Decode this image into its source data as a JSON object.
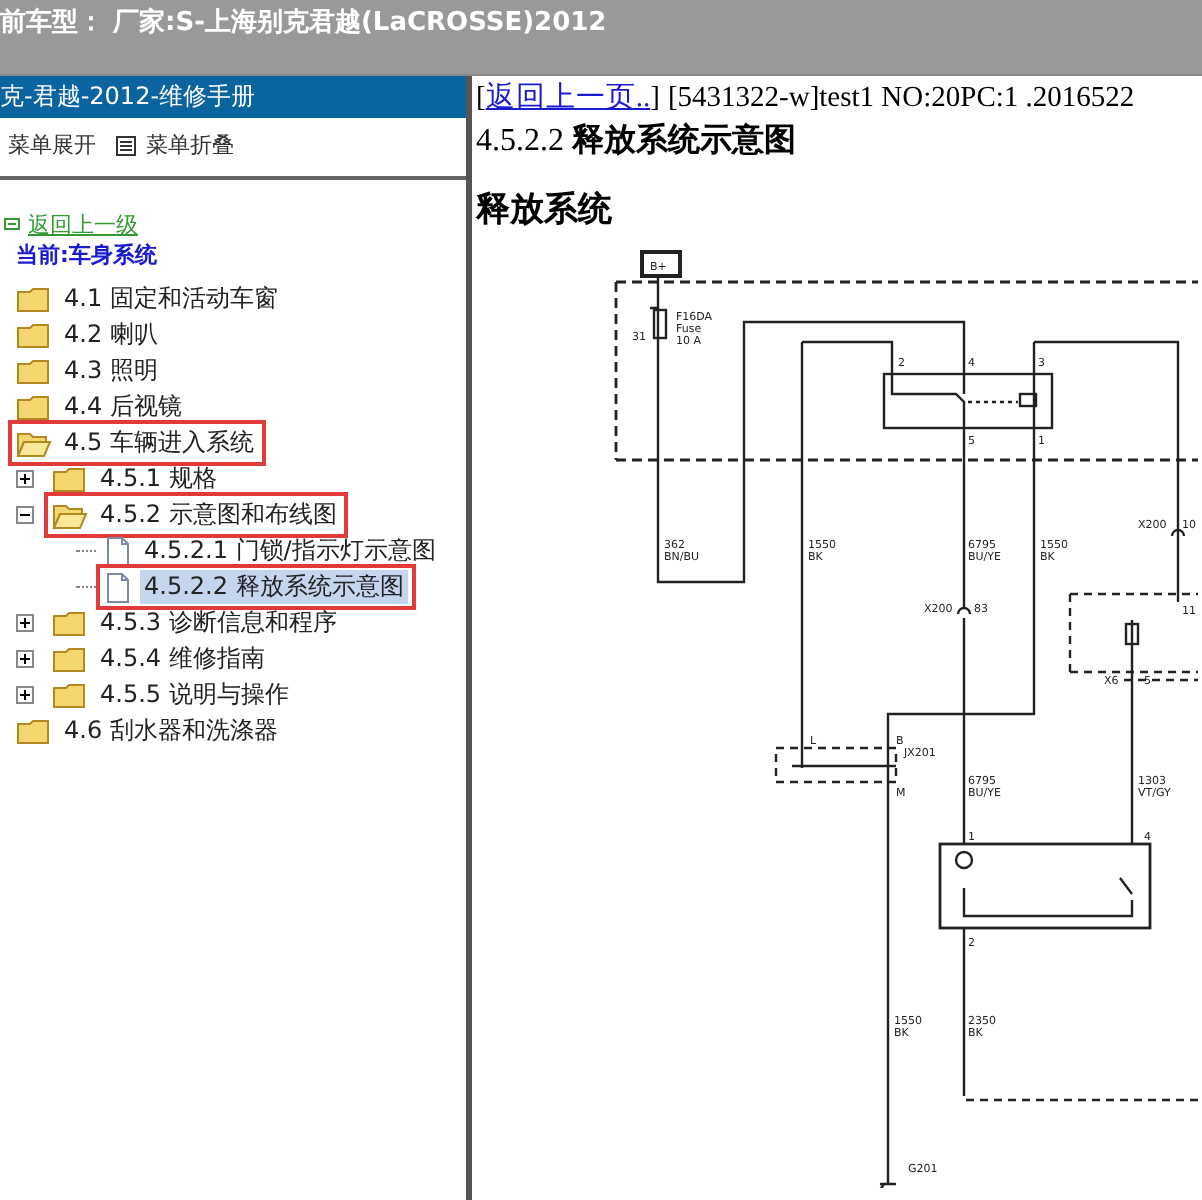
{
  "header": {
    "vehicle": "前车型： 厂家:S-上海别克君越(LaCROSSE)2012"
  },
  "sidebar": {
    "title": "克-君越-2012-维修手册",
    "toolbar": [
      {
        "kind": "expand",
        "label": "菜单展开"
      },
      {
        "kind": "collapse",
        "label": "菜单折叠"
      }
    ],
    "back_link": "返回上一级",
    "current": "当前:车身系统",
    "tree": [
      {
        "label": "4.1 固定和活动车窗",
        "kind": "folder",
        "selected": false,
        "highlighted": false
      },
      {
        "label": "4.2 喇叭",
        "kind": "folder",
        "selected": false,
        "highlighted": false
      },
      {
        "label": "4.3 照明",
        "kind": "folder",
        "selected": false,
        "highlighted": false
      },
      {
        "label": "4.4 后视镜",
        "kind": "folder",
        "selected": false,
        "highlighted": false
      },
      {
        "label": "4.5 车辆进入系统",
        "kind": "folder-open",
        "selected": false,
        "highlighted": true,
        "children": [
          {
            "label": "4.5.1 规格",
            "kind": "folder",
            "expanded": false,
            "selected": false,
            "highlighted": false
          },
          {
            "label": "4.5.2 示意图和布线图",
            "kind": "folder-open",
            "expanded": true,
            "selected": false,
            "highlighted": true,
            "children": [
              {
                "label": "4.5.2.1 门锁/指示灯示意图",
                "kind": "document",
                "selected": false,
                "highlighted": false
              },
              {
                "label": "4.5.2.2 释放系统示意图",
                "kind": "document",
                "selected": true,
                "highlighted": true
              }
            ]
          },
          {
            "label": "4.5.3 诊断信息和程序",
            "kind": "folder",
            "expanded": false,
            "selected": false,
            "highlighted": false
          },
          {
            "label": "4.5.4 维修指南",
            "kind": "folder",
            "expanded": false,
            "selected": false,
            "highlighted": false
          },
          {
            "label": "4.5.5 说明与操作",
            "kind": "folder",
            "expanded": false,
            "selected": false,
            "highlighted": false
          }
        ]
      },
      {
        "label": "4.6 刮水器和洗涤器",
        "kind": "folder",
        "selected": false,
        "highlighted": false
      }
    ]
  },
  "content": {
    "back_link": {
      "prefix": "[",
      "label": "返回上一页..",
      "suffix": "]"
    },
    "doc_ref": "[5431322-w]test1 NO:20PC:1 .2016522",
    "title": "4.5.2.2 **释放系统示意图**",
    "heading": "释放系统",
    "diagram_labels": [
      "B+",
      "F16DA",
      "Fuse",
      "10 A",
      "31",
      "2",
      "4",
      "3",
      "5",
      "1",
      "362",
      "BN/BU",
      "1550",
      "BK",
      "6795",
      "BU/YE",
      "1550",
      "BK",
      "X200",
      "10",
      "X200",
      "83",
      "L",
      "B",
      "JX201",
      "M",
      "6795",
      "BU/YE",
      "1303",
      "VT/GY",
      "X6",
      "5",
      "11",
      "1",
      "4",
      "2",
      "1550",
      "BK",
      "2350",
      "BK",
      "G201"
    ]
  }
}
